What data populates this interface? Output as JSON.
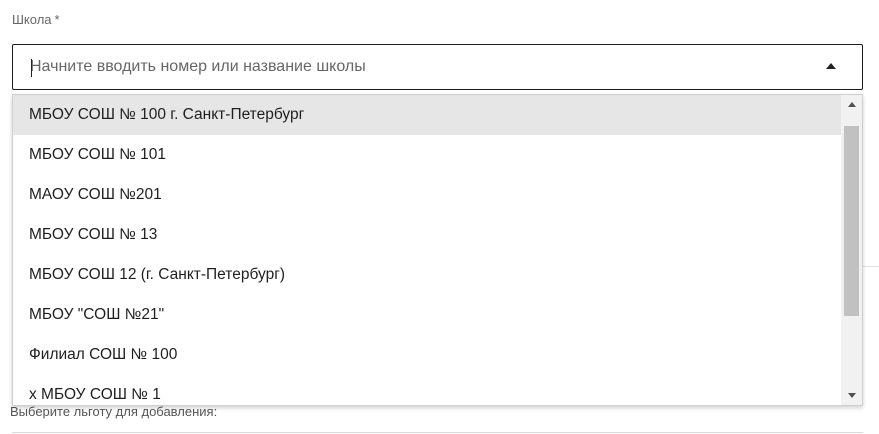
{
  "field": {
    "label": "Школа",
    "required_marker": "*",
    "input_value": "",
    "placeholder": "Начните вводить номер или название школы"
  },
  "dropdown": {
    "options": [
      "МБОУ СОШ № 100 г. Санкт-Петербург",
      "МБОУ СОШ № 101",
      "МАОУ СОШ №201",
      "МБОУ СОШ № 13",
      "МБОУ СОШ 12 (г. Санкт-Петербург)",
      "МБОУ \"СОШ №21\"",
      "Филиал СОШ № 100",
      "х МБОУ СОШ № 1"
    ],
    "highlighted_index": 0
  },
  "below": {
    "label": "Выберите льготу для добавления:"
  },
  "icons": {
    "dropdown_toggle": "triangle-up-icon",
    "scroll_up": "scroll-up-arrow-icon",
    "scroll_down": "scroll-down-arrow-icon"
  },
  "colors": {
    "highlight": "#e6e6e6",
    "border": "#1c1c1c",
    "scroll_thumb": "#c1c1c1"
  }
}
